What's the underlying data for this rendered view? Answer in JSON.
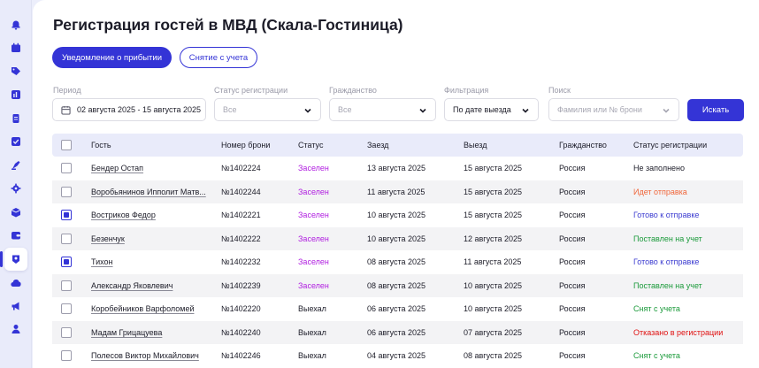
{
  "page": {
    "title": "Регистрация гостей в МВД (Скала-Гостиница)"
  },
  "actions": {
    "notify_label": "Уведомление о прибытии",
    "deregister_label": "Снятие с учета"
  },
  "filters": {
    "period": {
      "label": "Период",
      "value": "02 августа 2025 - 15 августа 2025"
    },
    "reg_status": {
      "label": "Статус регистрации",
      "value": "Все"
    },
    "citizenship": {
      "label": "Гражданство",
      "value": "Все"
    },
    "filtration": {
      "label": "Фильтрация",
      "value": "По дате выезда"
    },
    "search": {
      "label": "Поиск",
      "placeholder": "Фамилия или  № брони"
    },
    "search_button": "Искать"
  },
  "table": {
    "columns": [
      "Гость",
      "Номер брони",
      "Статус",
      "Заезд",
      "Выезд",
      "Гражданство",
      "Статус регистрации"
    ],
    "rows": [
      {
        "checked": false,
        "guest": "Бендер Остап",
        "booking": "№1402224",
        "status": "Заселен",
        "checkin": "13 августа 2025",
        "checkout": "15 августа 2025",
        "citizenship": "Россия",
        "reg": "Не заполнено"
      },
      {
        "checked": false,
        "guest": "Воробьянинов Ипполит Матв...",
        "booking": "№1402244",
        "status": "Заселен",
        "checkin": "11 августа 2025",
        "checkout": "15 августа 2025",
        "citizenship": "Россия",
        "reg": "Идет отправка"
      },
      {
        "checked": true,
        "guest": "Востриков Федор",
        "booking": "№1402221",
        "status": "Заселен",
        "checkin": "10 августа 2025",
        "checkout": "15 августа 2025",
        "citizenship": "Россия",
        "reg": "Готово к отправке"
      },
      {
        "checked": false,
        "guest": "Безенчук",
        "booking": "№1402222",
        "status": "Заселен",
        "checkin": "10 августа 2025",
        "checkout": "12 августа 2025",
        "citizenship": "Россия",
        "reg": "Поставлен на учет"
      },
      {
        "checked": true,
        "guest": "Тихон",
        "booking": "№1402232",
        "status": "Заселен",
        "checkin": "08 августа 2025",
        "checkout": "11 августа 2025",
        "citizenship": "Россия",
        "reg": "Готово к отправке"
      },
      {
        "checked": false,
        "guest": "Александр Яковлевич",
        "booking": "№1402239",
        "status": "Заселен",
        "checkin": "08 августа 2025",
        "checkout": "10 августа 2025",
        "citizenship": "Россия",
        "reg": "Поставлен на учет"
      },
      {
        "checked": false,
        "guest": "Коробейников Варфоломей",
        "booking": "№1402220",
        "status": "Выехал",
        "checkin": "06 августа 2025",
        "checkout": "10 августа 2025",
        "citizenship": "Россия",
        "reg": "Снят с учета"
      },
      {
        "checked": false,
        "guest": "Мадам Грицацуева",
        "booking": "№1402240",
        "status": "Выехал",
        "checkin": "06 августа 2025",
        "checkout": "07 августа 2025",
        "citizenship": "Россия",
        "reg": "Отказано в регистрации"
      },
      {
        "checked": false,
        "guest": "Полесов Виктор Михайлович",
        "booking": "№1402246",
        "status": "Выехал",
        "checkin": "04 августа 2025",
        "checkout": "08 августа 2025",
        "citizenship": "Россия",
        "reg": "Снят с учета"
      }
    ]
  },
  "colors": {
    "accent": "#3434d6",
    "status": {
      "Заселен": "#b01ee0",
      "Выехал": "#1c1c28"
    },
    "reg": {
      "Не заполнено": "#1c1c28",
      "Идет отправка": "#f0663a",
      "Готово к отправке": "#3a3ad0",
      "Поставлен на учет": "#1a9a3a",
      "Снят с учета": "#1a9a3a",
      "Отказано в регистрации": "#e01010"
    }
  },
  "sidebar": {
    "items": [
      {
        "icon": "bell-icon"
      },
      {
        "icon": "calendar-icon"
      },
      {
        "icon": "tag-icon"
      },
      {
        "icon": "chart-icon"
      },
      {
        "icon": "documents-icon"
      },
      {
        "icon": "checklist-icon"
      },
      {
        "icon": "broom-icon"
      },
      {
        "icon": "gear-icon"
      },
      {
        "icon": "box-icon"
      },
      {
        "icon": "wallet-icon"
      },
      {
        "icon": "badge-icon",
        "active": true
      },
      {
        "icon": "cloud-icon"
      },
      {
        "icon": "megaphone-icon"
      },
      {
        "icon": "user-icon"
      }
    ]
  }
}
